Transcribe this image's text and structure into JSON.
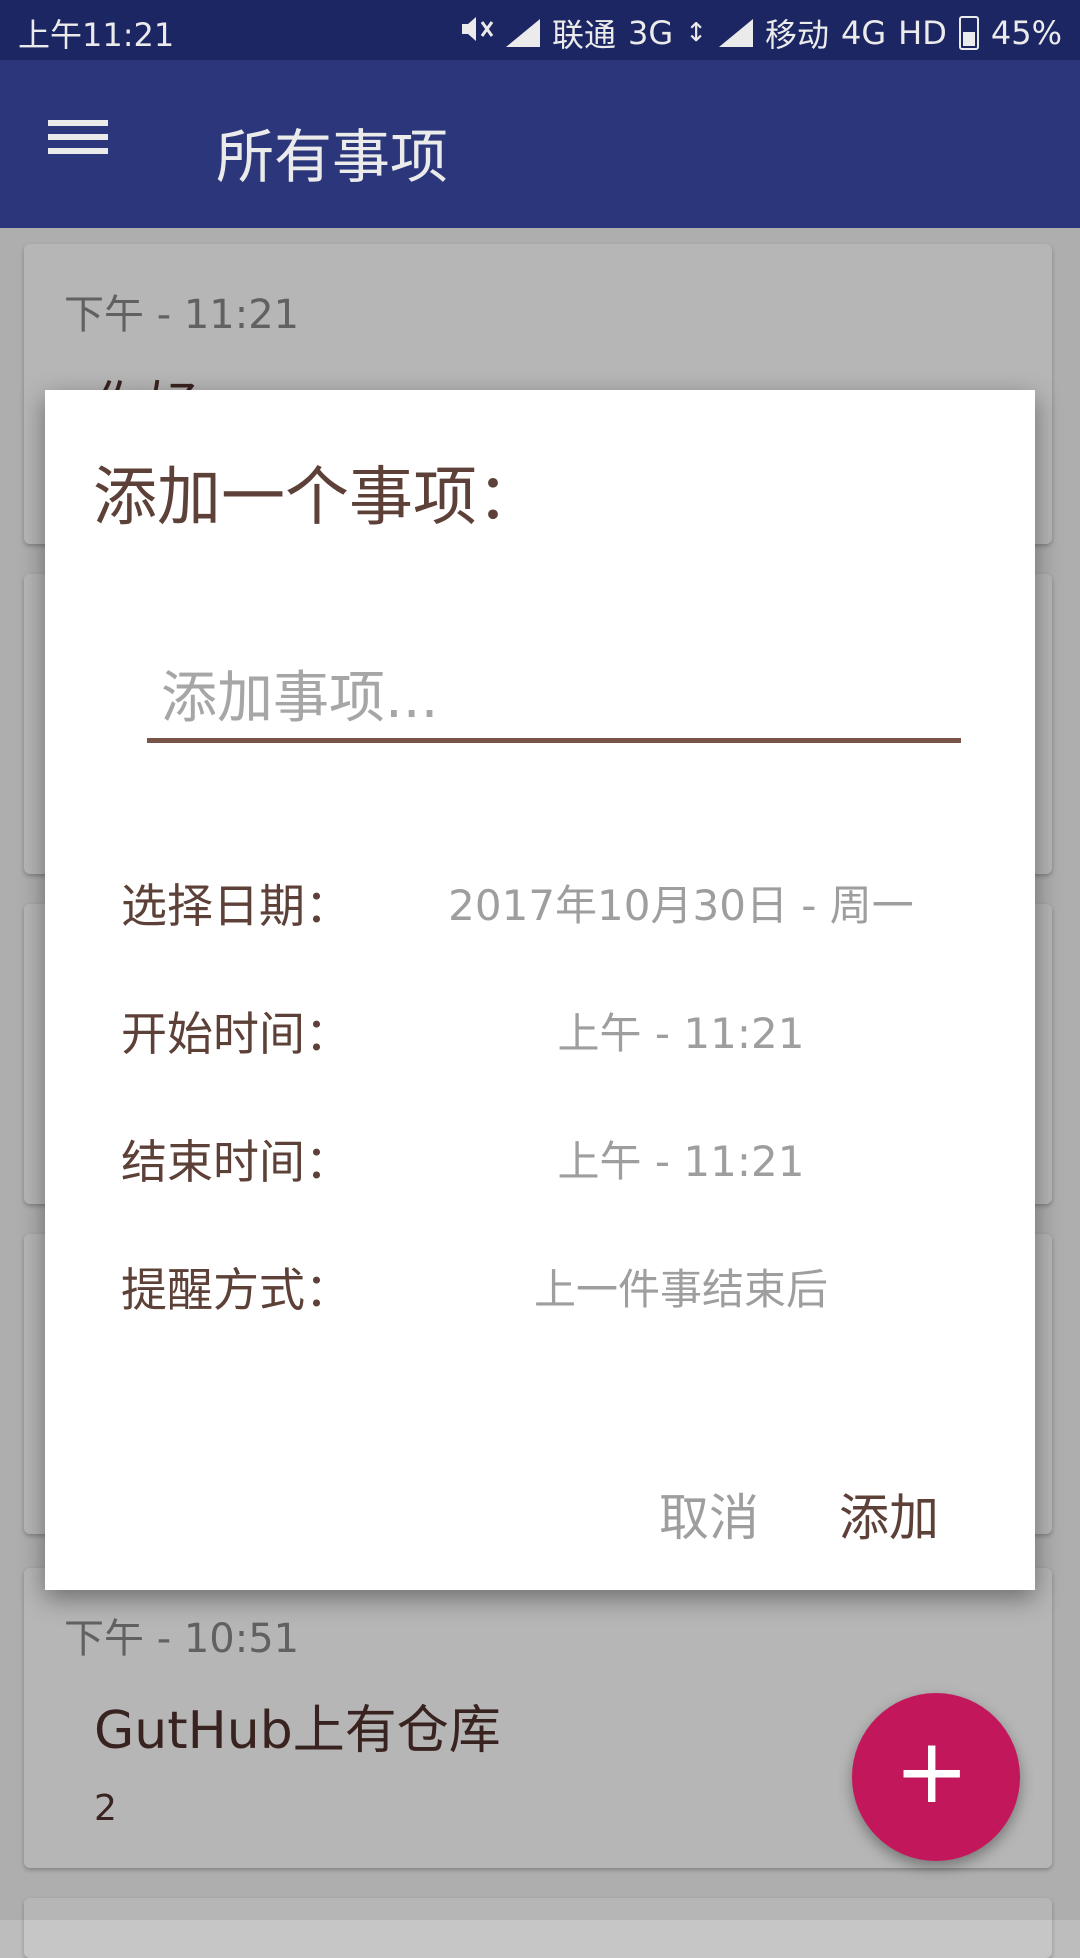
{
  "status_bar": {
    "time": "上午11:21",
    "carrier1": "联通",
    "net1": "3G",
    "carrier2": "移动",
    "net2": "4G",
    "hd": "HD",
    "battery": "45%",
    "icons": [
      "mute-icon",
      "signal-icon",
      "data-arrows-icon",
      "signal-icon",
      "battery-icon"
    ]
  },
  "app_bar": {
    "title": "所有事项",
    "menu_icon": "hamburger-menu-icon"
  },
  "background_cards": [
    {
      "time": "下午 - 11:21",
      "title": "你好",
      "note": ""
    },
    {
      "time": "下午 - 10:51",
      "title": "GutHub上有仓库",
      "note": "2"
    }
  ],
  "dialog": {
    "title": "添加一个事项：",
    "input_placeholder": "添加事项...",
    "input_value": "",
    "rows": [
      {
        "label": "选择日期：",
        "value": "2017年10月30日 - 周一"
      },
      {
        "label": "开始时间：",
        "value": "上午 - 11:21"
      },
      {
        "label": "结束时间：",
        "value": "上午 - 11:21"
      },
      {
        "label": "提醒方式：",
        "value": "上一件事结束后"
      }
    ],
    "cancel_label": "取消",
    "add_label": "添加"
  },
  "fab": {
    "icon": "plus-icon",
    "label": "+"
  },
  "colors": {
    "status_bar": "#1f2a6b",
    "app_bar": "#2f3c85",
    "accent": "#c2185b",
    "text_brown": "#5d4037"
  }
}
